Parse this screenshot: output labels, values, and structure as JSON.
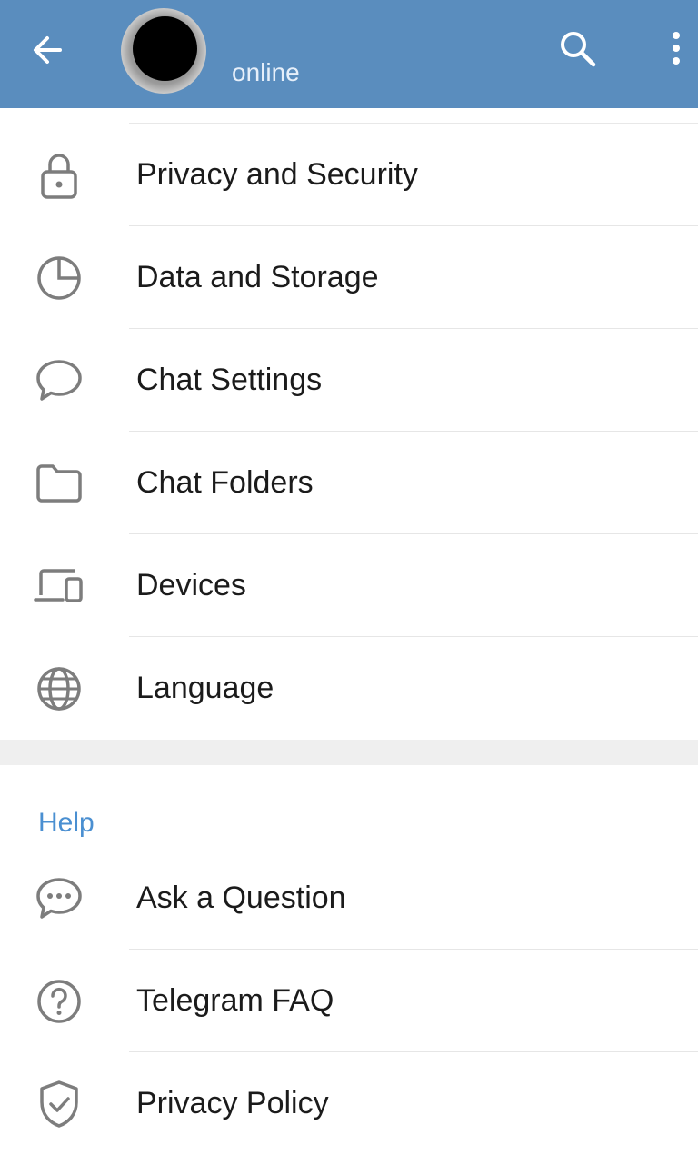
{
  "app_bar": {
    "status": "online",
    "background": "#5a8dbe",
    "icons": {
      "back": "arrow-left-icon",
      "search": "search-icon",
      "more": "more-vert-icon"
    }
  },
  "settings": {
    "items": [
      {
        "label": "Privacy and Security",
        "icon": "lock-icon"
      },
      {
        "label": "Data and Storage",
        "icon": "pie-chart-icon"
      },
      {
        "label": "Chat Settings",
        "icon": "chat-bubble-icon"
      },
      {
        "label": "Chat Folders",
        "icon": "folder-icon"
      },
      {
        "label": "Devices",
        "icon": "devices-icon"
      },
      {
        "label": "Language",
        "icon": "globe-icon"
      }
    ]
  },
  "help": {
    "header": "Help",
    "header_color": "#4a8fd1",
    "items": [
      {
        "label": "Ask a Question",
        "icon": "chat-dots-icon"
      },
      {
        "label": "Telegram FAQ",
        "icon": "question-circle-icon"
      },
      {
        "label": "Privacy Policy",
        "icon": "shield-check-icon"
      }
    ]
  }
}
